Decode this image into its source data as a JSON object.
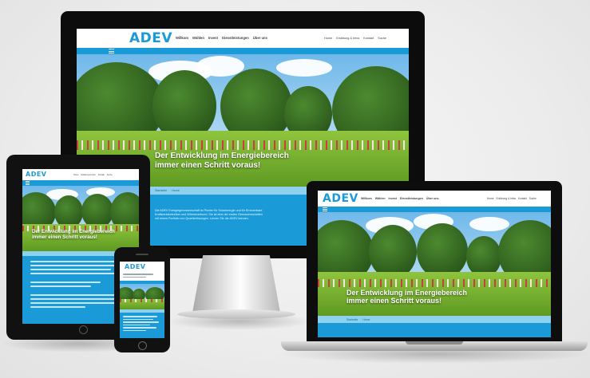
{
  "brand": {
    "logo": "ADEV",
    "accent": "#1a9bd7",
    "light_accent": "#8ed1ef"
  },
  "nav": {
    "main": [
      "Willkom",
      "Wählen",
      "Invest",
      "Dienstleistungen",
      "Über uns"
    ],
    "meta": [
      "Home",
      "Erklärung & Infos",
      "Kontakt",
      "Suche"
    ]
  },
  "menu_icon": "hamburger-icon",
  "hero": {
    "title_line1": "Der Entwicklung im Energiebereich",
    "title_line2": "immer einen Schritt voraus!"
  },
  "breadcrumb": [
    "Startseite",
    "Home"
  ],
  "content": {
    "intro": "Die ADEV Energiegenossenschaft ist Pionier für Solarenergie und für Erneuerbare",
    "intro2": "Kraftwerksbetreiber und Wärmeverbund. Sie ist eine der ersten Genossenschaften",
    "intro3": "mit einem Portfolio von Quartierlösungen. Lernen Sie die ADEV kennen."
  }
}
